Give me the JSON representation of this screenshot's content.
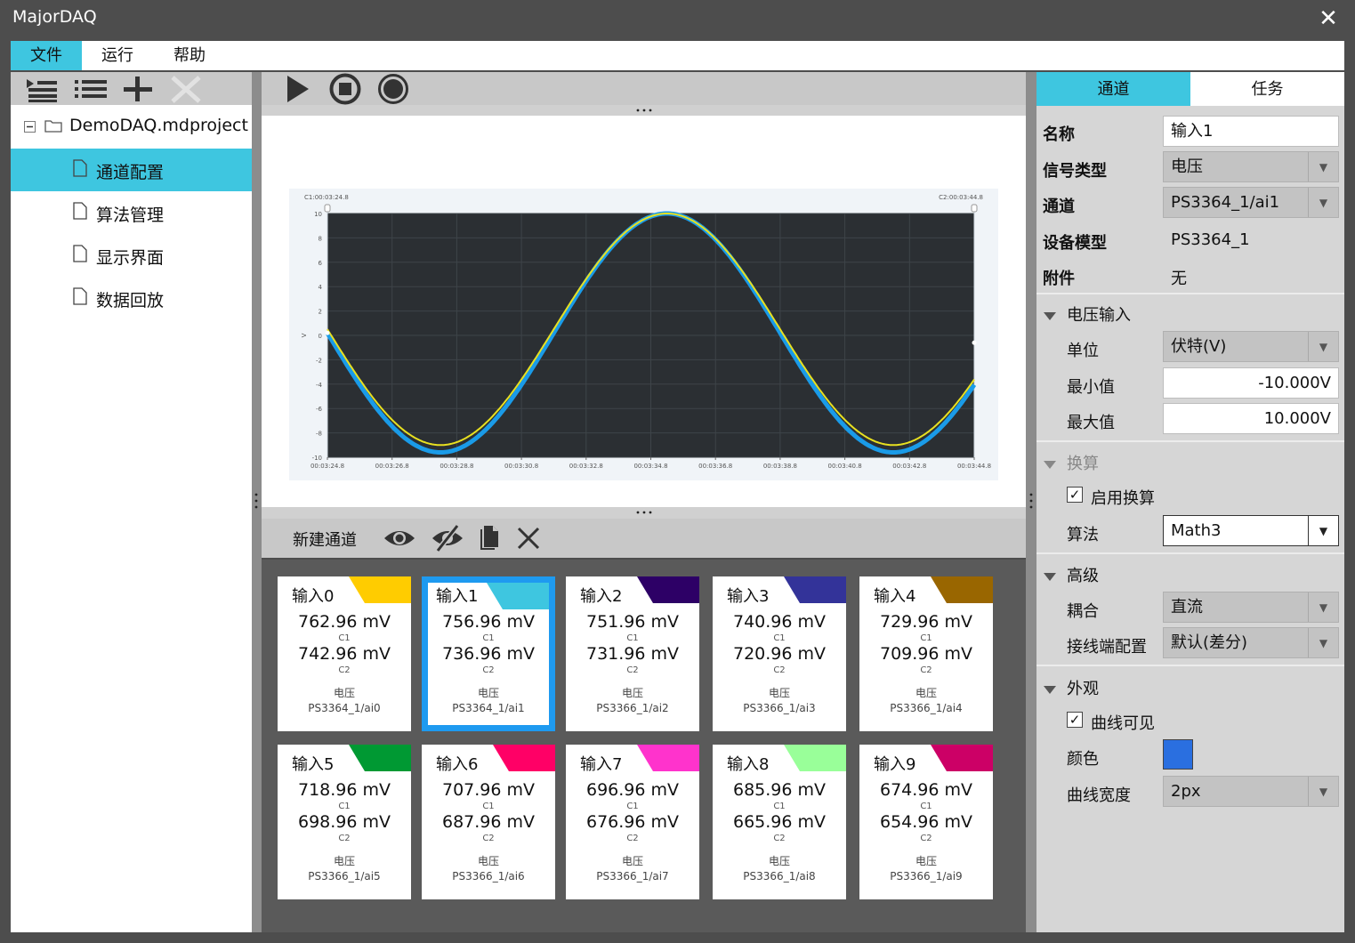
{
  "window": {
    "title": "MajorDAQ",
    "close_glyph": "✕"
  },
  "menu": {
    "file": "文件",
    "run": "运行",
    "help": "帮助"
  },
  "project": {
    "root": "DemoDAQ.mdproject",
    "items": [
      {
        "label": "通道配置",
        "selected": true
      },
      {
        "label": "算法管理",
        "selected": false
      },
      {
        "label": "显示界面",
        "selected": false
      },
      {
        "label": "数据回放",
        "selected": false
      }
    ]
  },
  "left_toolbar_icons": [
    "tree-list-icon",
    "list-icon",
    "add-icon",
    "delete-icon"
  ],
  "center_toolbar_icons": [
    "play-icon",
    "stop-icon",
    "record-icon"
  ],
  "chart_data": {
    "type": "line",
    "cursor_left_label": "C1:00:03:24.8",
    "cursor_right_label": "C2:00:03:44.8",
    "ylabel": "V",
    "ylim": [
      -10,
      10
    ],
    "y_ticks": [
      10,
      8,
      6,
      4,
      2,
      0,
      -2,
      -4,
      -6,
      -8,
      -10
    ],
    "x_ticks": [
      "00:03:24.8",
      "00:03:26.8",
      "00:03:28.8",
      "00:03:30.8",
      "00:03:32.8",
      "00:03:34.8",
      "00:03:36.8",
      "00:03:38.8",
      "00:03:40.8",
      "00:03:42.8",
      "00:03:44.8"
    ],
    "xlim": [
      0,
      20
    ],
    "grid": true,
    "series": [
      {
        "color": "#1a9be8",
        "width": 5,
        "period": 14,
        "phase_deg": 180,
        "amplitude": 9.8,
        "offset": 0.2
      },
      {
        "color": "#e8e020",
        "width": 2,
        "period": 14,
        "phase_deg": 180,
        "amplitude": 9.5,
        "offset": 0.5
      }
    ]
  },
  "channels_toolbar": {
    "new_channel": "新建通道",
    "icons": [
      "eye-icon",
      "eye-slash-icon",
      "copy-icon",
      "delete-icon"
    ]
  },
  "channels": [
    {
      "name": "输入0",
      "color": "#ffcc00",
      "v1": "762.96  mV",
      "c1": "C1",
      "v2": "742.96  mV",
      "c2": "C2",
      "signal": "电压",
      "device": "PS3364_1/ai0",
      "selected": false
    },
    {
      "name": "输入1",
      "color": "#3ec6e0",
      "v1": "756.96  mV",
      "c1": "C1",
      "v2": "736.96  mV",
      "c2": "C2",
      "signal": "电压",
      "device": "PS3364_1/ai1",
      "selected": true
    },
    {
      "name": "输入2",
      "color": "#2d0066",
      "v1": "751.96  mV",
      "c1": "C1",
      "v2": "731.96  mV",
      "c2": "C2",
      "signal": "电压",
      "device": "PS3366_1/ai2",
      "selected": false
    },
    {
      "name": "输入3",
      "color": "#333399",
      "v1": "740.96  mV",
      "c1": "C1",
      "v2": "720.96  mV",
      "c2": "C2",
      "signal": "电压",
      "device": "PS3366_1/ai3",
      "selected": false
    },
    {
      "name": "输入4",
      "color": "#996600",
      "v1": "729.96  mV",
      "c1": "C1",
      "v2": "709.96  mV",
      "c2": "C2",
      "signal": "电压",
      "device": "PS3366_1/ai4",
      "selected": false
    },
    {
      "name": "输入5",
      "color": "#009933",
      "v1": "718.96  mV",
      "c1": "C1",
      "v2": "698.96  mV",
      "c2": "C2",
      "signal": "电压",
      "device": "PS3366_1/ai5",
      "selected": false
    },
    {
      "name": "输入6",
      "color": "#ff0066",
      "v1": "707.96  mV",
      "c1": "C1",
      "v2": "687.96  mV",
      "c2": "C2",
      "signal": "电压",
      "device": "PS3366_1/ai6",
      "selected": false
    },
    {
      "name": "输入7",
      "color": "#ff33cc",
      "v1": "696.96  mV",
      "c1": "C1",
      "v2": "676.96  mV",
      "c2": "C2",
      "signal": "电压",
      "device": "PS3366_1/ai7",
      "selected": false
    },
    {
      "name": "输入8",
      "color": "#99ff99",
      "v1": "685.96  mV",
      "c1": "C1",
      "v2": "665.96  mV",
      "c2": "C2",
      "signal": "电压",
      "device": "PS3366_1/ai8",
      "selected": false
    },
    {
      "name": "输入9",
      "color": "#cc0066",
      "v1": "674.96  mV",
      "c1": "C1",
      "v2": "654.96  mV",
      "c2": "C2",
      "signal": "电压",
      "device": "PS3366_1/ai9",
      "selected": false
    }
  ],
  "props": {
    "tabs": {
      "channel": "通道",
      "task": "任务"
    },
    "name_label": "名称",
    "name_value": "输入1",
    "signal_type_label": "信号类型",
    "signal_type_value": "电压",
    "channel_label": "通道",
    "channel_value": "PS3364_1/ai1",
    "device_model_label": "设备模型",
    "device_model_value": "PS3364_1",
    "accessory_label": "附件",
    "accessory_value": "无",
    "voltage_section": "电压输入",
    "unit_label": "单位",
    "unit_value": "伏特(V)",
    "min_label": "最小值",
    "min_value": "-10.000V",
    "max_label": "最大值",
    "max_value": "10.000V",
    "convert_section": "换算",
    "enable_convert_label": "启用换算",
    "enable_convert_checked": true,
    "algorithm_label": "算法",
    "algorithm_value": "Math3",
    "advanced_section": "高级",
    "coupling_label": "耦合",
    "coupling_value": "直流",
    "terminal_label": "接线端配置",
    "terminal_value": "默认(差分)",
    "appearance_section": "外观",
    "curve_visible_label": "曲线可见",
    "curve_visible_checked": true,
    "color_label": "颜色",
    "color_value": "#2a6fe0",
    "curve_width_label": "曲线宽度",
    "curve_width_value": "2px"
  }
}
